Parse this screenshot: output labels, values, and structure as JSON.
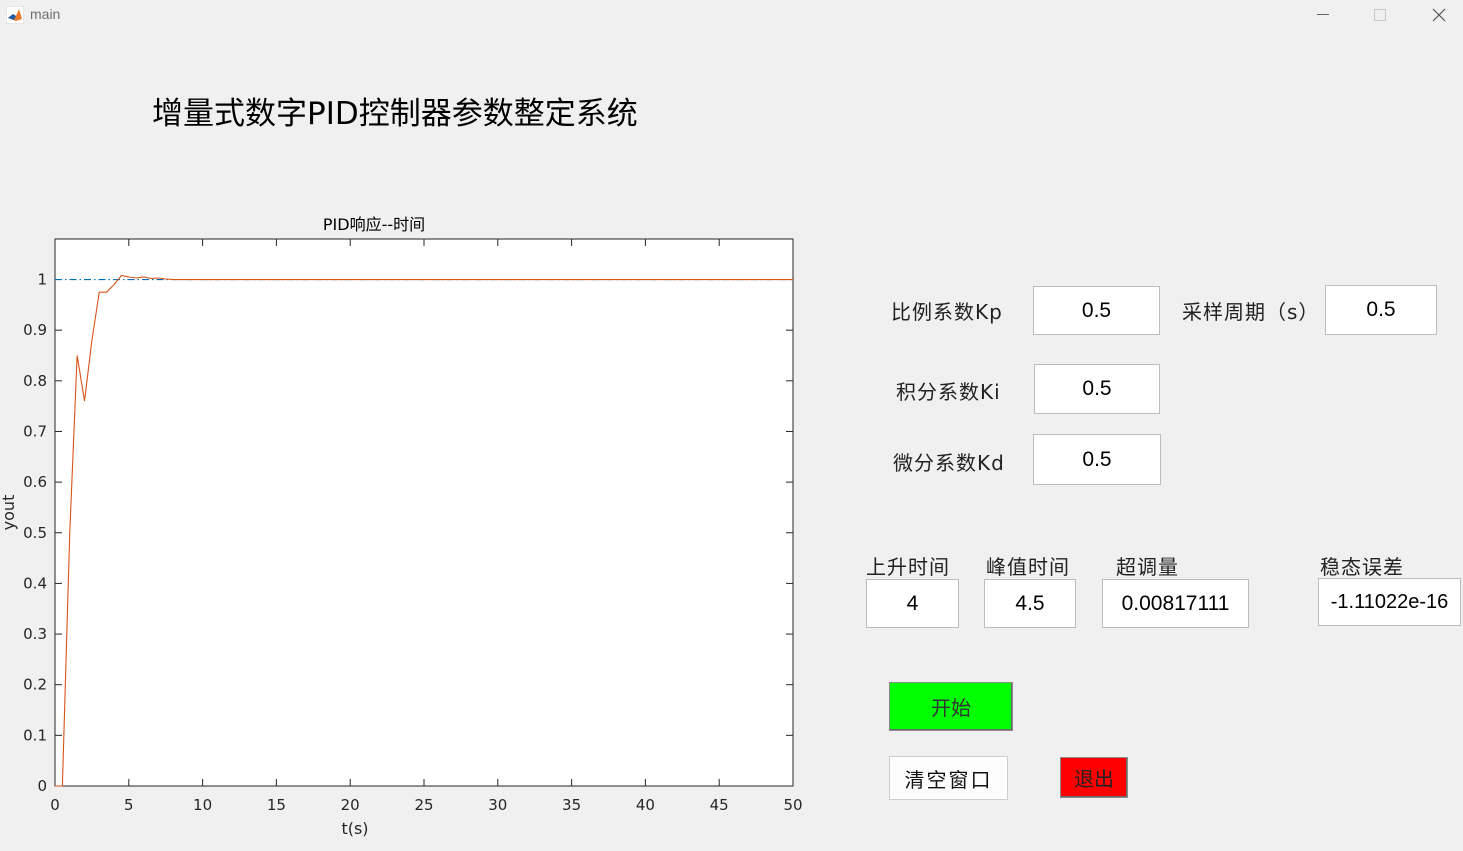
{
  "window": {
    "title": "main"
  },
  "app_title": "增量式数字PID控制器参数整定系统",
  "params": {
    "kp": {
      "label": "比例系数Kp",
      "value": "0.5"
    },
    "ki": {
      "label": "积分系数Ki",
      "value": "0.5"
    },
    "kd": {
      "label": "微分系数Kd",
      "value": "0.5"
    },
    "ts": {
      "label": "采样周期（s）",
      "value": "0.5"
    }
  },
  "metrics": {
    "rise_time": {
      "label": "上升时间",
      "value": "4"
    },
    "peak_time": {
      "label": "峰值时间",
      "value": "4.5"
    },
    "overshoot": {
      "label": "超调量",
      "value": "0.00817111"
    },
    "steady_error": {
      "label": "稳态误差",
      "value": "-1.11022e-16"
    }
  },
  "buttons": {
    "start": "开始",
    "clear": "清空窗口",
    "exit": "退出"
  },
  "colors": {
    "start_bg": "#00ff00",
    "exit_bg": "#ff0000",
    "response_line": "#d95319",
    "reference_line": "#0072bd"
  },
  "chart_data": {
    "type": "line",
    "title": "PID响应--时间",
    "xlabel": "t(s)",
    "ylabel": "yout",
    "xlim": [
      0,
      50
    ],
    "ylim": [
      0,
      1.08
    ],
    "xticks": [
      0,
      5,
      10,
      15,
      20,
      25,
      30,
      35,
      40,
      45,
      50
    ],
    "yticks": [
      0,
      0.1,
      0.2,
      0.3,
      0.4,
      0.5,
      0.6,
      0.7,
      0.8,
      0.9,
      1
    ],
    "grid": false,
    "legend": "none",
    "series": [
      {
        "style": "dash-dot",
        "color": "#0072bd",
        "x": [
          0,
          0.5,
          1,
          1.5,
          2,
          2.5,
          3,
          3.5,
          4,
          4.5,
          5,
          5.5,
          6,
          6.5,
          7,
          7.5,
          8,
          50
        ],
        "y": [
          1,
          1,
          1,
          1,
          1,
          1,
          1,
          1,
          1,
          1,
          1,
          1,
          1,
          1,
          1,
          1,
          1,
          1
        ]
      },
      {
        "style": "solid",
        "color": "#d95319",
        "x": [
          0,
          0.5,
          1,
          1.5,
          2,
          2.5,
          3,
          3.5,
          4,
          4.5,
          5,
          5.5,
          6,
          6.5,
          7,
          7.5,
          8,
          50
        ],
        "y": [
          0,
          0,
          0.5,
          0.85,
          0.76,
          0.88,
          0.975,
          0.975,
          0.99,
          1.008,
          1.005,
          1.003,
          1.005,
          1.002,
          1.003,
          1.001,
          1,
          1
        ]
      }
    ]
  }
}
